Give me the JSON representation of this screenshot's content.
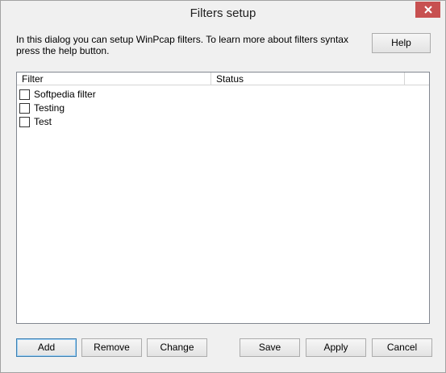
{
  "window": {
    "title": "Filters setup"
  },
  "description": "In this dialog you can setup WinPcap filters. To learn more about filters syntax press the help button.",
  "help_button": "Help",
  "filter_list": {
    "columns": [
      "Filter",
      "Status"
    ],
    "rows": [
      {
        "name": "Softpedia filter",
        "checked": false,
        "status": ""
      },
      {
        "name": "Testing",
        "checked": false,
        "status": ""
      },
      {
        "name": "Test",
        "checked": false,
        "status": ""
      }
    ]
  },
  "buttons": {
    "add": "Add",
    "remove": "Remove",
    "change": "Change",
    "save": "Save",
    "apply": "Apply",
    "cancel": "Cancel"
  },
  "icons": {
    "close": "close-icon"
  },
  "colors": {
    "close_button": "#c75050",
    "window_bg": "#f0f0f0",
    "default_button_border": "#3c7fb1"
  }
}
